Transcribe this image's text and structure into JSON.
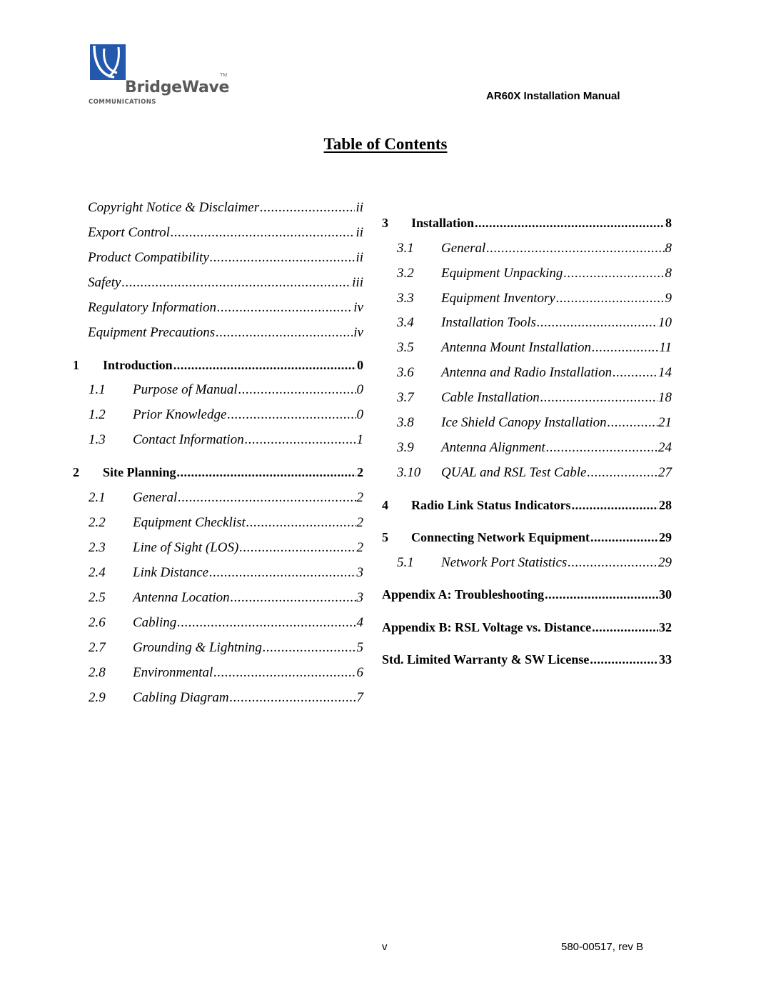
{
  "logo": {
    "brand": "BridgeWave",
    "tagline": "COMMUNICATIONS",
    "trademark": "TM",
    "colors": {
      "mark": "#2358ad",
      "text": "#5a5a5a"
    }
  },
  "header": {
    "title": "AR60X Installation Manual"
  },
  "toc": {
    "title": "Table of Contents",
    "left_column": [
      {
        "level": 0,
        "num": "",
        "label": "Copyright Notice & Disclaimer",
        "page": "ii"
      },
      {
        "level": 0,
        "num": "",
        "label": "Export Control",
        "page": "ii"
      },
      {
        "level": 0,
        "num": "",
        "label": "Product Compatibility",
        "page": "ii"
      },
      {
        "level": 0,
        "num": "",
        "label": "Safety",
        "page": "iii"
      },
      {
        "level": 0,
        "num": "",
        "label": "Regulatory Information",
        "page": "iv"
      },
      {
        "level": 0,
        "num": "",
        "label": "Equipment Precautions",
        "page": "iv"
      },
      {
        "level": 1,
        "num": "1",
        "label": "Introduction",
        "page": "0"
      },
      {
        "level": 2,
        "num": "1.1",
        "label": "Purpose of Manual",
        "page": "0"
      },
      {
        "level": 2,
        "num": "1.2",
        "label": "Prior Knowledge",
        "page": "0"
      },
      {
        "level": 2,
        "num": "1.3",
        "label": "Contact Information",
        "page": "1"
      },
      {
        "level": 1,
        "num": "2",
        "label": "Site Planning",
        "page": "2"
      },
      {
        "level": 2,
        "num": "2.1",
        "label": "General",
        "page": "2"
      },
      {
        "level": 2,
        "num": "2.2",
        "label": "Equipment Checklist",
        "page": "2"
      },
      {
        "level": 2,
        "num": "2.3",
        "label": "Line of Sight (LOS)",
        "page": "2"
      },
      {
        "level": 2,
        "num": "2.4",
        "label": "Link Distance",
        "page": "3"
      },
      {
        "level": 2,
        "num": "2.5",
        "label": "Antenna Location",
        "page": "3"
      },
      {
        "level": 2,
        "num": "2.6",
        "label": "Cabling",
        "page": "4"
      },
      {
        "level": 2,
        "num": "2.7",
        "label": "Grounding & Lightning",
        "page": "5"
      },
      {
        "level": 2,
        "num": "2.8",
        "label": "Environmental",
        "page": "6"
      },
      {
        "level": 2,
        "num": "2.9",
        "label": "Cabling Diagram",
        "page": "7"
      }
    ],
    "right_column": [
      {
        "level": 1,
        "num": "3",
        "label": "Installation",
        "page": "8"
      },
      {
        "level": 2,
        "num": "3.1",
        "label": "General",
        "page": "8"
      },
      {
        "level": 2,
        "num": "3.2",
        "label": "Equipment Unpacking",
        "page": "8"
      },
      {
        "level": 2,
        "num": "3.3",
        "label": "Equipment Inventory",
        "page": "9"
      },
      {
        "level": 2,
        "num": "3.4",
        "label": "Installation Tools",
        "page": "10"
      },
      {
        "level": 2,
        "num": "3.5",
        "label": "Antenna Mount Installation",
        "page": "11"
      },
      {
        "level": 2,
        "num": "3.6",
        "label": "Antenna and Radio Installation",
        "page": "14"
      },
      {
        "level": 2,
        "num": "3.7",
        "label": "Cable Installation",
        "page": "18"
      },
      {
        "level": 2,
        "num": "3.8",
        "label": "Ice Shield Canopy Installation",
        "page": "21"
      },
      {
        "level": 2,
        "num": "3.9",
        "label": "Antenna Alignment",
        "page": "24"
      },
      {
        "level": 2,
        "num": "3.10",
        "label": "QUAL and RSL Test Cable",
        "page": "27"
      },
      {
        "level": 1,
        "num": "4",
        "label": "Radio Link Status Indicators",
        "page": "28"
      },
      {
        "level": 1,
        "num": "5",
        "label": "Connecting Network Equipment",
        "page": "29"
      },
      {
        "level": 2,
        "num": "5.1",
        "label": "Network Port Statistics",
        "page": "29"
      },
      {
        "level": 1,
        "num": "",
        "label": "Appendix A: Troubleshooting",
        "page": "30"
      },
      {
        "level": 1,
        "num": "",
        "label": "Appendix B: RSL Voltage vs. Distance",
        "page": "32"
      },
      {
        "level": 1,
        "num": "",
        "label": "Std. Limited Warranty & SW License",
        "page": "33"
      }
    ]
  },
  "footer": {
    "page_number": "v",
    "doc_number": "580-00517, rev B"
  }
}
